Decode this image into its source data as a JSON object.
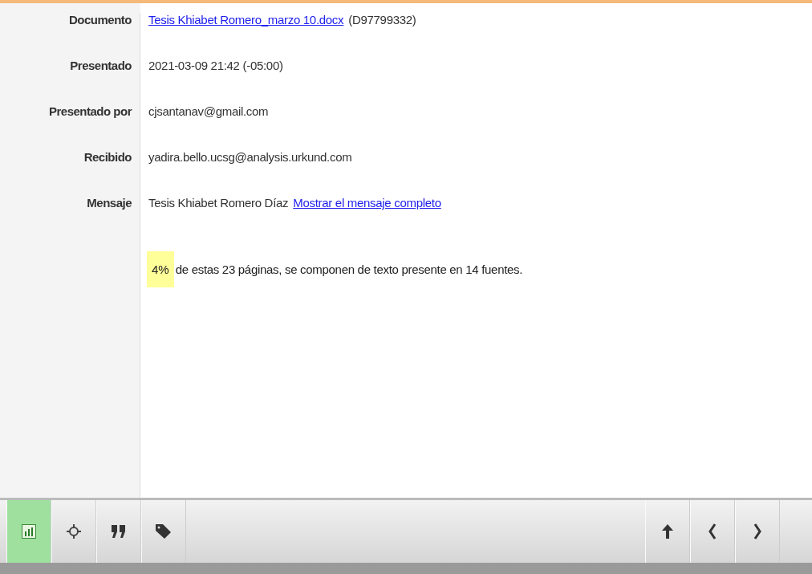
{
  "details": [
    {
      "kind": "link",
      "label": "Documento",
      "link": "Tesis Khiabet Romero_marzo 10.docx",
      "text": "(D97799332)"
    },
    {
      "kind": "plain",
      "label": "Presentado",
      "text": "2021-03-09 21:42 (-05:00)"
    },
    {
      "kind": "plain",
      "label": "Presentado por",
      "text": "cjsantanav@gmail.com"
    },
    {
      "kind": "plain",
      "label": "Recibido",
      "text": "yadira.bello.ucsg@analysis.urkund.com"
    },
    {
      "kind": "message",
      "label": "Mensaje",
      "text": "Tesis Khiabet Romero Díaz",
      "link": "Mostrar el mensaje completo"
    }
  ],
  "summary": {
    "percent": "4%",
    "text": "de estas 23 páginas, se componen de texto presente en 14 fuentes."
  },
  "toolbar": {
    "left": [
      {
        "selected": true
      },
      {
        "selected": false
      },
      {
        "selected": false
      },
      {
        "selected": false
      }
    ],
    "right": [
      {
        "selected": false
      },
      {
        "selected": false
      },
      {
        "selected": false
      }
    ]
  }
}
